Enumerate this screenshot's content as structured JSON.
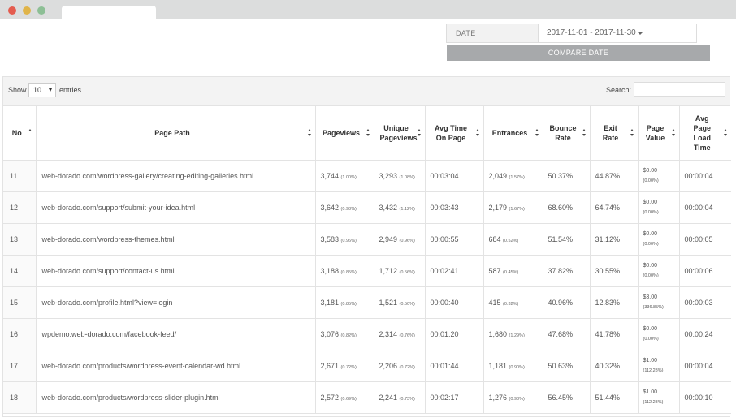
{
  "filters": {
    "date_label": "DATE",
    "date_range": "2017-11-01 - 2017-11-30",
    "compare_label": "COMPARE DATE"
  },
  "table_controls": {
    "show_label": "Show",
    "entries_value": "10",
    "entries_label": "entries",
    "search_label": "Search:"
  },
  "columns": [
    {
      "label": "No"
    },
    {
      "label": "Page Path"
    },
    {
      "label": "Pageviews"
    },
    {
      "label": "Unique Pageviews"
    },
    {
      "label": "Avg Time On Page"
    },
    {
      "label": "Entrances"
    },
    {
      "label": "Bounce Rate"
    },
    {
      "label": "Exit Rate"
    },
    {
      "label": "Page Value"
    },
    {
      "label": "Avg Page Load Time"
    }
  ],
  "rows": [
    {
      "no": "11",
      "path": "web-dorado.com/wordpress-gallery/creating-editing-galleries.html",
      "pageviews": "3,744",
      "pageviews_pct": "(1.00%)",
      "unique": "3,293",
      "unique_pct": "(1.08%)",
      "avg_time": "00:03:04",
      "entrances": "2,049",
      "entrances_pct": "(1.57%)",
      "bounce": "50.37%",
      "exit": "44.87%",
      "value": "$0.00",
      "value_pct": "(0.00%)",
      "load": "00:00:04"
    },
    {
      "no": "12",
      "path": "web-dorado.com/support/submit-your-idea.html",
      "pageviews": "3,642",
      "pageviews_pct": "(0.98%)",
      "unique": "3,432",
      "unique_pct": "(1.12%)",
      "avg_time": "00:03:43",
      "entrances": "2,179",
      "entrances_pct": "(1.67%)",
      "bounce": "68.60%",
      "exit": "64.74%",
      "value": "$0.00",
      "value_pct": "(0.00%)",
      "load": "00:00:04"
    },
    {
      "no": "13",
      "path": "web-dorado.com/wordpress-themes.html",
      "pageviews": "3,583",
      "pageviews_pct": "(0.96%)",
      "unique": "2,949",
      "unique_pct": "(0.96%)",
      "avg_time": "00:00:55",
      "entrances": "684",
      "entrances_pct": "(0.52%)",
      "bounce": "51.54%",
      "exit": "31.12%",
      "value": "$0.00",
      "value_pct": "(0.00%)",
      "load": "00:00:05"
    },
    {
      "no": "14",
      "path": "web-dorado.com/support/contact-us.html",
      "pageviews": "3,188",
      "pageviews_pct": "(0.85%)",
      "unique": "1,712",
      "unique_pct": "(0.56%)",
      "avg_time": "00:02:41",
      "entrances": "587",
      "entrances_pct": "(0.45%)",
      "bounce": "37.82%",
      "exit": "30.55%",
      "value": "$0.00",
      "value_pct": "(0.00%)",
      "load": "00:00:06"
    },
    {
      "no": "15",
      "path": "web-dorado.com/profile.html?view=login",
      "pageviews": "3,181",
      "pageviews_pct": "(0.85%)",
      "unique": "1,521",
      "unique_pct": "(0.50%)",
      "avg_time": "00:00:40",
      "entrances": "415",
      "entrances_pct": "(0.32%)",
      "bounce": "40.96%",
      "exit": "12.83%",
      "value": "$3.00",
      "value_pct": "(336.85%)",
      "load": "00:00:03"
    },
    {
      "no": "16",
      "path": "wpdemo.web-dorado.com/facebook-feed/",
      "pageviews": "3,076",
      "pageviews_pct": "(0.82%)",
      "unique": "2,314",
      "unique_pct": "(0.76%)",
      "avg_time": "00:01:20",
      "entrances": "1,680",
      "entrances_pct": "(1.29%)",
      "bounce": "47.68%",
      "exit": "41.78%",
      "value": "$0.00",
      "value_pct": "(0.00%)",
      "load": "00:00:24"
    },
    {
      "no": "17",
      "path": "web-dorado.com/products/wordpress-event-calendar-wd.html",
      "pageviews": "2,671",
      "pageviews_pct": "(0.72%)",
      "unique": "2,206",
      "unique_pct": "(0.72%)",
      "avg_time": "00:01:44",
      "entrances": "1,181",
      "entrances_pct": "(0.90%)",
      "bounce": "50.63%",
      "exit": "40.32%",
      "value": "$1.00",
      "value_pct": "(112.28%)",
      "load": "00:00:04"
    },
    {
      "no": "18",
      "path": "web-dorado.com/products/wordpress-slider-plugin.html",
      "pageviews": "2,572",
      "pageviews_pct": "(0.69%)",
      "unique": "2,241",
      "unique_pct": "(0.73%)",
      "avg_time": "00:02:17",
      "entrances": "1,276",
      "entrances_pct": "(0.98%)",
      "bounce": "56.45%",
      "exit": "51.44%",
      "value": "$1.00",
      "value_pct": "(112.28%)",
      "load": "00:00:10"
    }
  ]
}
